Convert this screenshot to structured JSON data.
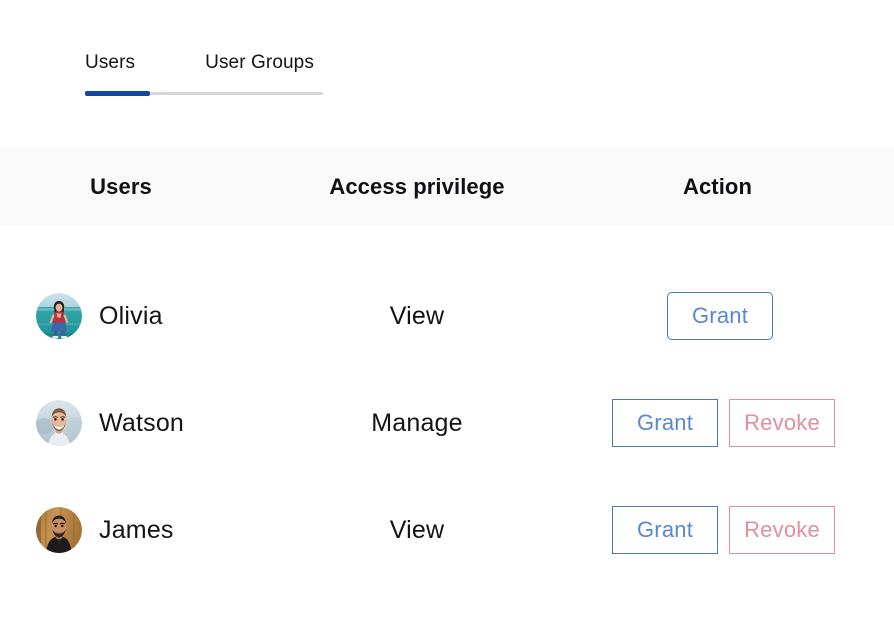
{
  "tabs": [
    {
      "label": "Users",
      "active": true
    },
    {
      "label": "User Groups",
      "active": false
    }
  ],
  "table": {
    "columns": [
      "Users",
      "Access privilege",
      "Action"
    ],
    "rows": [
      {
        "user": "Olivia",
        "avatar": "olivia-avatar",
        "privilege": "View",
        "actions": [
          "Grant"
        ]
      },
      {
        "user": "Watson",
        "avatar": "watson-avatar",
        "privilege": "Manage",
        "actions": [
          "Grant",
          "Revoke"
        ]
      },
      {
        "user": "James",
        "avatar": "james-avatar",
        "privilege": "View",
        "actions": [
          "Grant",
          "Revoke"
        ]
      }
    ]
  },
  "buttons": {
    "grant_label": "Grant",
    "revoke_label": "Revoke"
  },
  "colors": {
    "active_tab_underline": "#10499b",
    "inactive_tab_rail": "#d6d8da",
    "header_background": "#fafafa",
    "grant_border": "#4a79c4",
    "grant_text": "#5b87cf",
    "revoke_border": "#e0909f",
    "revoke_text": "#e08f9e",
    "text_primary": "#121416"
  }
}
